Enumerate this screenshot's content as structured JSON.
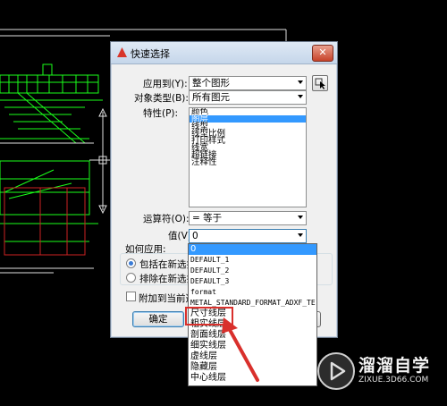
{
  "dialog": {
    "title": "快速选择",
    "close_label": "✕",
    "apply_to": {
      "label": "应用到(Y):",
      "value": "整个图形"
    },
    "object_type": {
      "label": "对象类型(B):",
      "value": "所有图元"
    },
    "properties": {
      "label": "特性(P):",
      "items": [
        "颜色",
        "图层",
        "线型",
        "线型比例",
        "打印样式",
        "线宽",
        "超链接",
        "注释性"
      ],
      "selected_index": 1
    },
    "operator": {
      "label": "运算符(O):",
      "value": "= 等于"
    },
    "value": {
      "label": "值(V):",
      "value": "0"
    },
    "how_to_apply": {
      "label": "如何应用:",
      "include": "包括在新选择",
      "exclude": "排除在新选择"
    },
    "append_label": "附加到当前选择",
    "ok_label": "确定"
  },
  "value_dropdown": {
    "items": [
      "0",
      "DEFAULT_1",
      "DEFAULT_2",
      "DEFAULT_3",
      "format",
      "METAL_STANDARD_FORMAT_ADXF_TE",
      "尺寸线层",
      "粗实线层",
      "剖面线层",
      "细实线层",
      "虚线层",
      "隐藏层",
      "中心线层"
    ],
    "selected_index": 0,
    "highlighted_item": "尺寸线层"
  },
  "watermark": {
    "brand": "溜溜自学",
    "url": "ZIXUE.3D66.COM"
  },
  "colors": {
    "selection": "#3399ff",
    "annotation_red": "#d9302c",
    "cad_green": "#1aff1a",
    "cad_background": "#000000"
  }
}
